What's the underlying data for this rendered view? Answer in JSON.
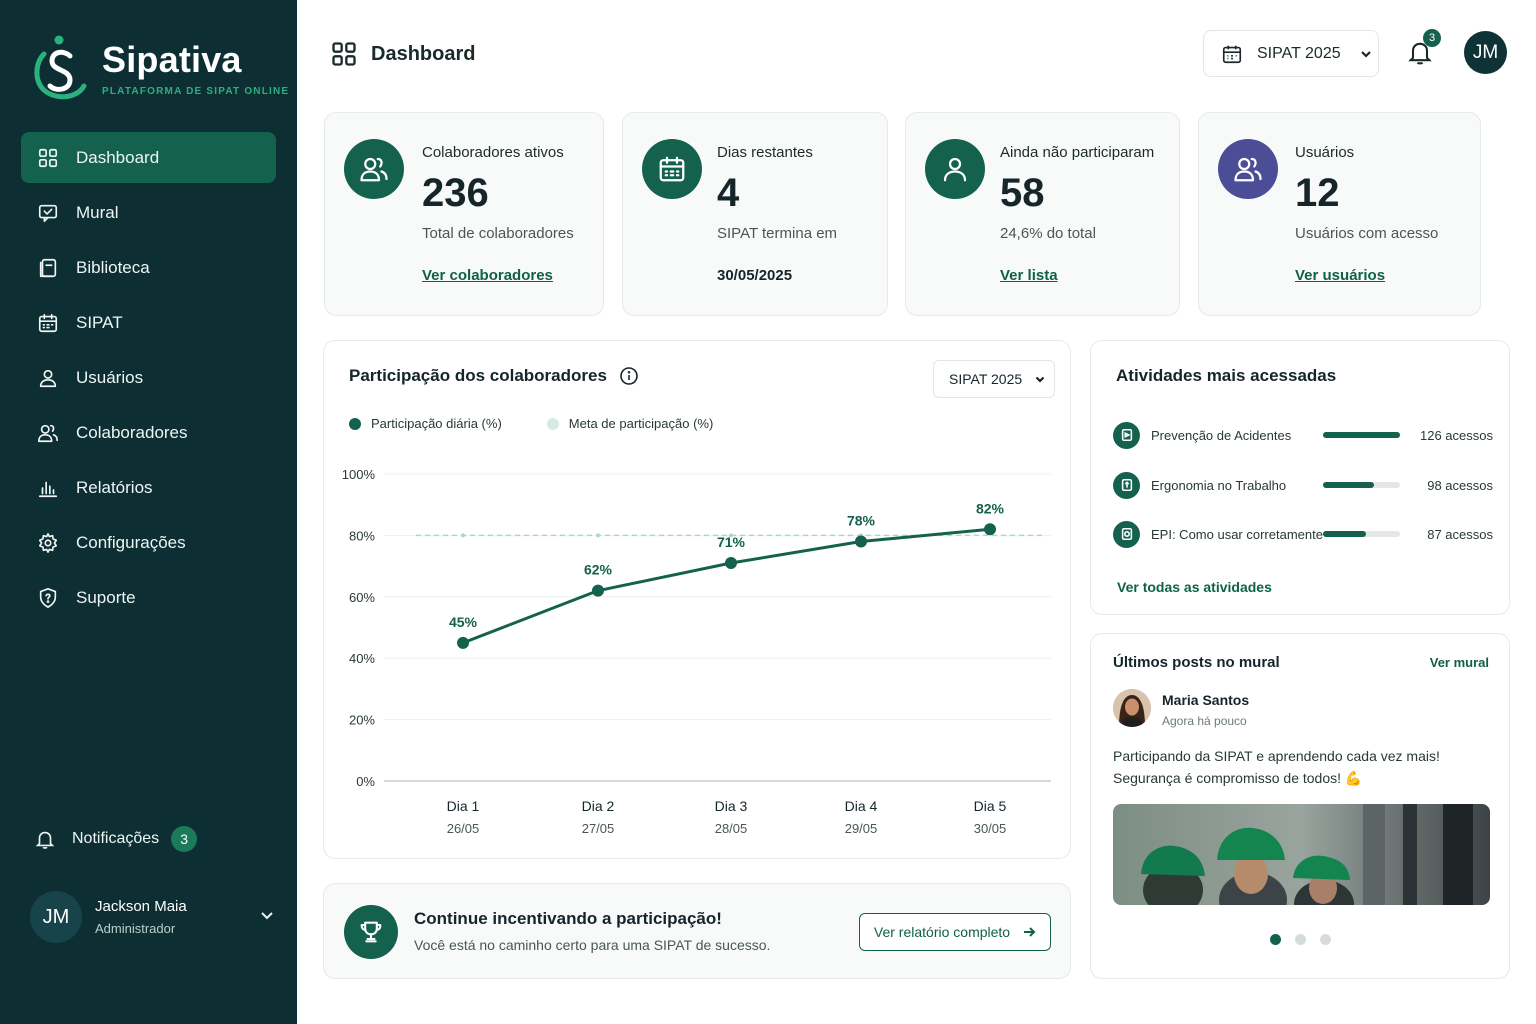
{
  "brand": {
    "name": "Sipativa",
    "tagline": "PLATAFORMA DE SIPAT ONLINE",
    "accent": "#2bb07f",
    "sidebar_bg": "#0d2f34"
  },
  "sidebar": {
    "items": [
      {
        "label": "Dashboard",
        "icon": "grid-icon",
        "active": true
      },
      {
        "label": "Mural",
        "icon": "message-board-icon"
      },
      {
        "label": "Biblioteca",
        "icon": "library-icon"
      },
      {
        "label": "SIPAT",
        "icon": "calendar-icon"
      },
      {
        "label": "Usuários",
        "icon": "user-icon"
      },
      {
        "label": "Colaboradores",
        "icon": "users-icon"
      },
      {
        "label": "Relatórios",
        "icon": "bar-chart-icon"
      },
      {
        "label": "Configurações",
        "icon": "gear-icon"
      },
      {
        "label": "Suporte",
        "icon": "shield-question-icon"
      }
    ],
    "notifications": {
      "label": "Notificações",
      "count": "3"
    },
    "user": {
      "initials": "JM",
      "name": "Jackson Maia",
      "role": "Administrador"
    }
  },
  "header": {
    "title": "Dashboard",
    "year_select": "SIPAT 2025",
    "bell_count": "3",
    "avatar_initials": "JM"
  },
  "stats": [
    {
      "label": "Colaboradores ativos",
      "value": "236",
      "sub": "Total de colaboradores",
      "link": "Ver colaboradores",
      "icon": "users-icon"
    },
    {
      "label": "Dias restantes",
      "value": "4",
      "sub": "SIPAT termina em",
      "date": "30/05/2025",
      "icon": "calendar-icon"
    },
    {
      "label": "Ainda não participaram",
      "value": "58",
      "sub": "24,6% do total",
      "link": "Ver lista",
      "icon": "user-icon"
    },
    {
      "label": "Usuários",
      "value": "12",
      "sub": "Usuários com acesso",
      "link": "Ver usuários",
      "icon": "users-icon"
    }
  ],
  "participation": {
    "title": "Participação dos colaboradores",
    "select": "SIPAT 2025",
    "legend": [
      "Participação diária (%)",
      "Meta de participação (%)"
    ]
  },
  "chart_data": {
    "type": "line",
    "title": "Participação dos colaboradores",
    "categories": [
      "Dia 1",
      "Dia 2",
      "Dia 3",
      "Dia 4",
      "Dia 5"
    ],
    "dates": [
      "26/05",
      "27/05",
      "28/05",
      "29/05",
      "30/05"
    ],
    "series": [
      {
        "name": "Participação diária (%)",
        "values": [
          45,
          62,
          71,
          78,
          82
        ],
        "color": "#14614d"
      },
      {
        "name": "Meta de participação (%)",
        "values": [
          80,
          80,
          80,
          80,
          80
        ],
        "color": "#a9d9c6"
      }
    ],
    "value_labels": [
      "45%",
      "62%",
      "71%",
      "78%",
      "82%"
    ],
    "yticks": [
      "0%",
      "20%",
      "40%",
      "60%",
      "80%",
      "100%"
    ],
    "ylim": [
      0,
      100
    ],
    "grid": true,
    "legend_position": "top-left"
  },
  "incentive": {
    "title": "Continue incentivando a participação!",
    "subtitle": "Você está no caminho certo para uma SIPAT de sucesso.",
    "button": "Ver relatório completo"
  },
  "activities": {
    "title": "Atividades mais acessadas",
    "items": [
      {
        "name": "Prevenção de Acidentes",
        "count": "126 acessos",
        "fraction": 1.0
      },
      {
        "name": "Ergonomia no Trabalho",
        "count": "98 acessos",
        "fraction": 0.66
      },
      {
        "name": "EPI: Como usar corretamente",
        "count": "87 acessos",
        "fraction": 0.56
      }
    ],
    "link": "Ver todas as atividades"
  },
  "mural": {
    "title": "Últimos posts no mural",
    "link": "Ver mural",
    "post": {
      "author": "Maria Santos",
      "time": "Agora há pouco",
      "text": "Participando da SIPAT e aprendendo cada vez mais! Segurança é compromisso de todos! 💪"
    },
    "carousel_active": 1,
    "carousel_total": 3
  }
}
